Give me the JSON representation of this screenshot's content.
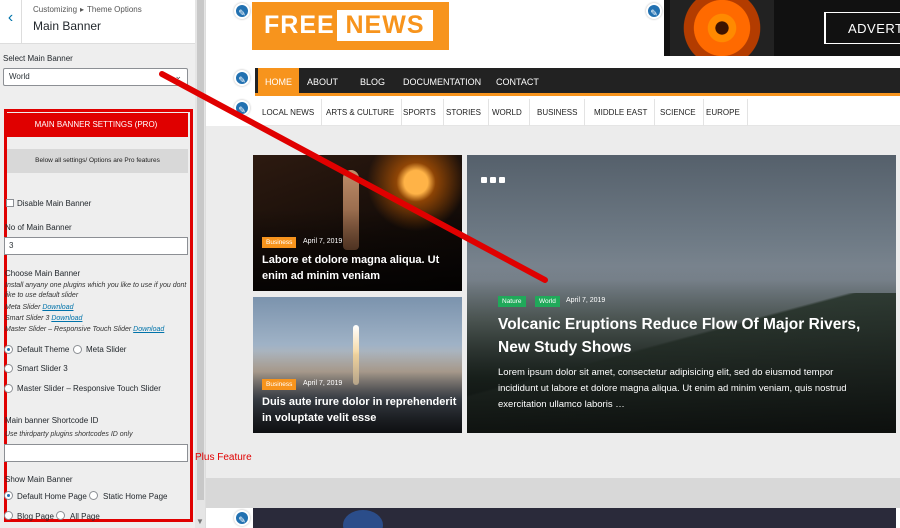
{
  "panel": {
    "back_icon": "chevron-left-icon",
    "breadcrumb": [
      "Customizing",
      "Theme Options"
    ],
    "breadcrumb_sep": "▸",
    "title": "Main Banner",
    "select_label": "Select Main Banner",
    "select_value": "World",
    "pro_button": "MAIN BANNER SETTINGS (PRO)",
    "pro_note": "Below all settings/ Options are Pro features",
    "disable_label": "Disable Main Banner",
    "count_label": "No of Main Banner",
    "count_value": "3",
    "choose_label": "Choose Main Banner",
    "choose_help": "Install anyany one plugins which you like to use if you dont like to use default slider",
    "meta_slider_text": "Meta Slider",
    "smart_slider_text": "Smart Slider 3",
    "master_slider_text": "Master Slider – Responsive Touch Slider",
    "download": "Download",
    "radio_default": "Default Theme",
    "radio_meta": "Meta Slider",
    "radio_smart": "Smart Slider 3",
    "radio_master": "Master Slider – Responsive Touch Slider",
    "shortcode_label": "Main banner Shortcode ID",
    "shortcode_help": "Use thirdparty plugins shortcodes ID only",
    "shortcode_value": "",
    "show_label": "Show Main Banner",
    "show_default_home": "Default Home Page",
    "show_static_home": "Static Home Page",
    "show_blog": "Blog Page",
    "show_all": "All Page",
    "plus_feature": "Plus Feature",
    "accent": "#e00000"
  },
  "site": {
    "logo_left": "FREE",
    "logo_right": "NEWS",
    "ad_text": "ADVERT",
    "main_nav": [
      "HOME",
      "ABOUT",
      "BLOG",
      "DOCUMENTATION",
      "CONTACT"
    ],
    "sub_nav": [
      "LOCAL NEWS",
      "ARTS & CULTURE",
      "SPORTS",
      "STORIES",
      "WORLD",
      "BUSINESS",
      "MIDDLE EAST",
      "SCIENCE",
      "EUROPE"
    ],
    "brand_color": "#f7941d",
    "edit_icon": "pencil-icon"
  },
  "posts": [
    {
      "category": "Business",
      "date": "April 7, 2019",
      "title": "Labore et dolore magna aliqua. Ut enim ad minim veniam"
    },
    {
      "category": "Business",
      "date": "April 7, 2019",
      "title": "Duis aute irure dolor in reprehenderit in voluptate velit esse"
    }
  ],
  "featured": {
    "categories": [
      "Nature",
      "World"
    ],
    "date": "April 7, 2019",
    "title": "Volcanic Eruptions Reduce Flow Of Major Rivers, New Study Shows",
    "excerpt": "Lorem ipsum dolor sit amet, consectetur adipisicing elit, sed do eiusmod tempor incididunt ut labore et dolore magna aliqua. Ut enim ad minim veniam, quis nostrud exercitation ullamco laboris …"
  }
}
